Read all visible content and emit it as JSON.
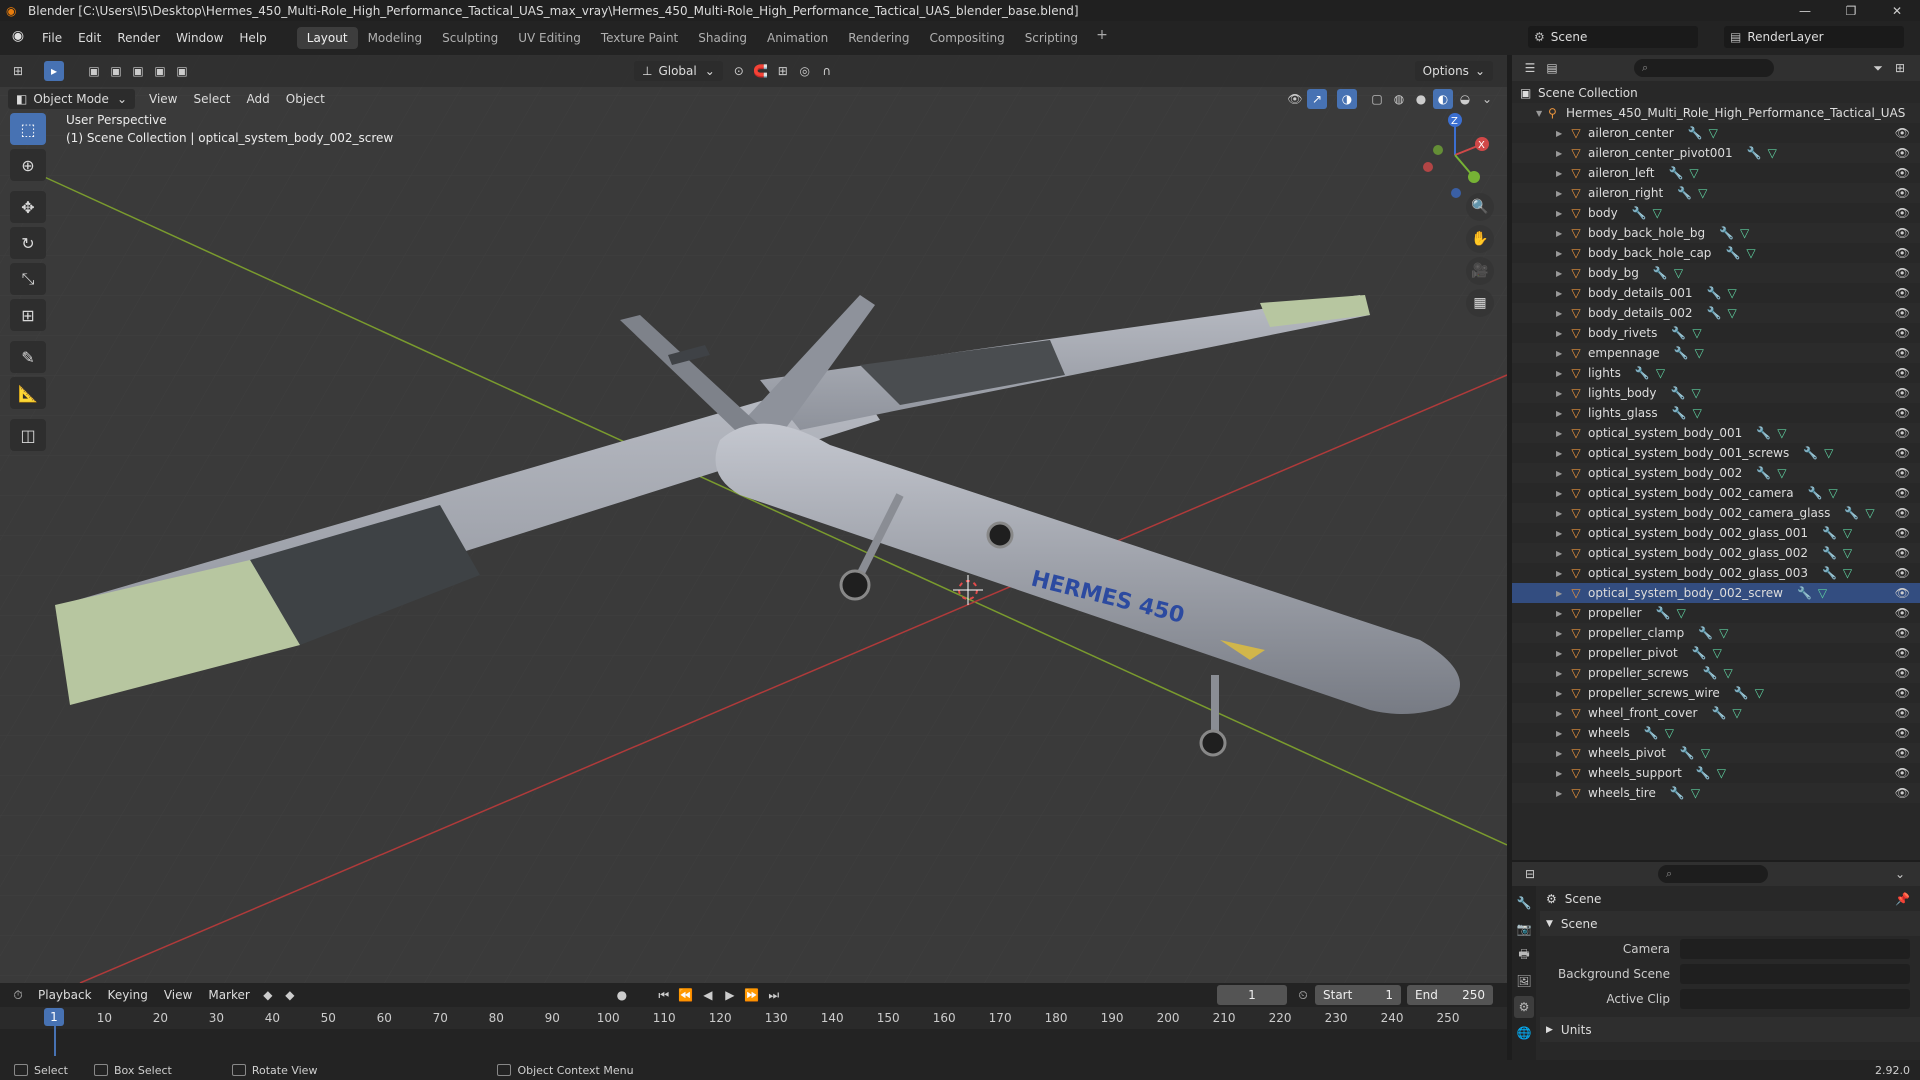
{
  "titlebar": {
    "title": "Blender [C:\\Users\\I5\\Desktop\\Hermes_450_Multi-Role_High_Performance_Tactical_UAS_max_vray\\Hermes_450_Multi-Role_High_Performance_Tactical_UAS_blender_base.blend]"
  },
  "menu": [
    "File",
    "Edit",
    "Render",
    "Window",
    "Help"
  ],
  "workspaces": [
    "Layout",
    "Modeling",
    "Sculpting",
    "UV Editing",
    "Texture Paint",
    "Shading",
    "Animation",
    "Rendering",
    "Compositing",
    "Scripting"
  ],
  "scene": {
    "name": "Scene",
    "layer": "RenderLayer"
  },
  "viewport": {
    "transform_orientation": "Global",
    "options": "Options",
    "mode": "Object Mode",
    "menus": [
      "View",
      "Select",
      "Add",
      "Object"
    ],
    "info_line1": "User Perspective",
    "info_line2": "(1) Scene Collection | optical_system_body_002_screw",
    "model_label": "HERMES 450"
  },
  "outliner": {
    "root": "Scene Collection",
    "collection": "Hermes_450_Multi_Role_High_Performance_Tactical_UAS",
    "items": [
      "aileron_center",
      "aileron_center_pivot001",
      "aileron_left",
      "aileron_right",
      "body",
      "body_back_hole_bg",
      "body_back_hole_cap",
      "body_bg",
      "body_details_001",
      "body_details_002",
      "body_rivets",
      "empennage",
      "lights",
      "lights_body",
      "lights_glass",
      "optical_system_body_001",
      "optical_system_body_001_screws",
      "optical_system_body_002",
      "optical_system_body_002_camera",
      "optical_system_body_002_camera_glass",
      "optical_system_body_002_glass_001",
      "optical_system_body_002_glass_002",
      "optical_system_body_002_glass_003",
      "optical_system_body_002_screw",
      "propeller",
      "propeller_clamp",
      "propeller_pivot",
      "propeller_screws",
      "propeller_screws_wire",
      "wheel_front_cover",
      "wheels",
      "wheels_pivot",
      "wheels_support",
      "wheels_tire"
    ],
    "selected": "optical_system_body_002_screw"
  },
  "properties": {
    "context": "Scene",
    "panel": "Scene",
    "fields": [
      "Camera",
      "Background Scene",
      "Active Clip"
    ],
    "collapsed": "Units",
    "version": "2.92.0"
  },
  "timeline": {
    "menus": [
      "Playback",
      "Keying",
      "View",
      "Marker"
    ],
    "current": "1",
    "start_label": "Start",
    "start": "1",
    "end_label": "End",
    "end": "250",
    "ticks": [
      "1",
      "10",
      "20",
      "30",
      "40",
      "50",
      "60",
      "70",
      "80",
      "90",
      "100",
      "110",
      "120",
      "130",
      "140",
      "150",
      "160",
      "170",
      "180",
      "190",
      "200",
      "210",
      "220",
      "230",
      "240",
      "250"
    ]
  },
  "statusbar": [
    "Select",
    "Box Select",
    "Rotate View",
    "Object Context Menu"
  ]
}
